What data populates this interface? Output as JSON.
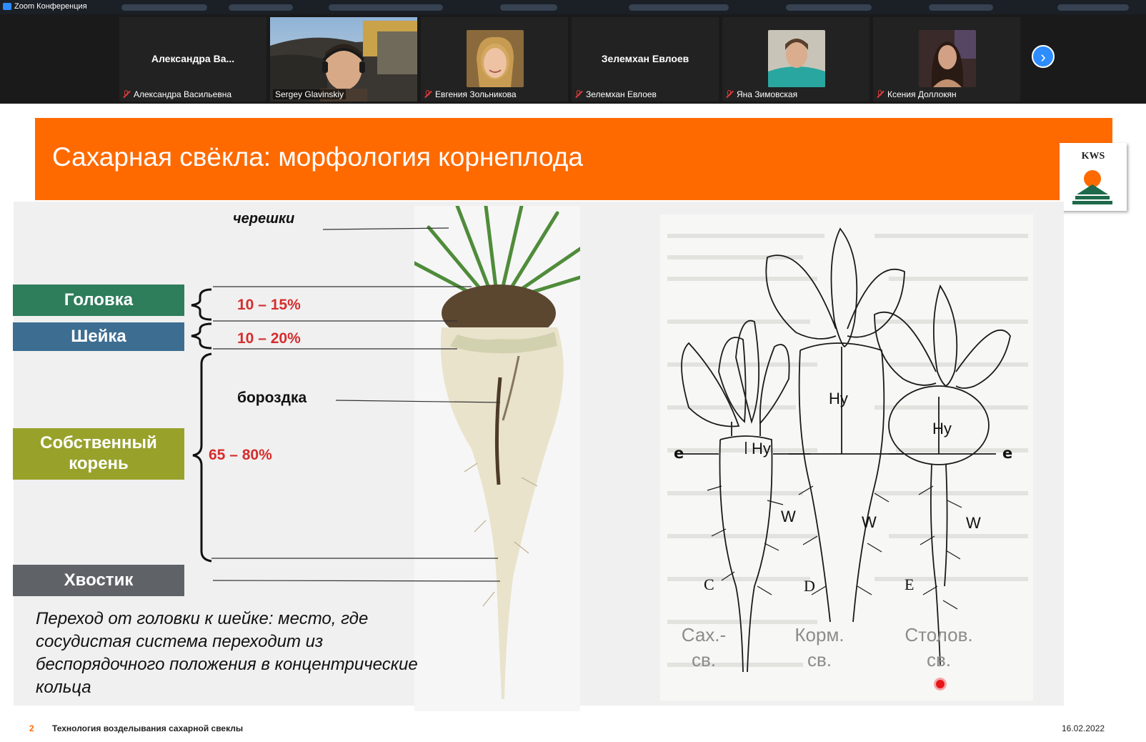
{
  "window": {
    "title": "Zoom Конференция"
  },
  "participants": {
    "tiles": [
      {
        "big_name": "Александра   Ва...",
        "name": "Александра Васильевна",
        "muted": true
      },
      {
        "big_name": "",
        "name": "Sergey Glavinskiy",
        "muted": false,
        "active": true
      },
      {
        "big_name": "",
        "name": "Евгения Зольникова",
        "muted": true
      },
      {
        "big_name": "Зелемхан Евлоев",
        "name": "Зелемхан Евлоев",
        "muted": true
      },
      {
        "big_name": "",
        "name": "Яна Зимовская",
        "muted": true
      },
      {
        "big_name": "",
        "name": "Ксения Доллокян",
        "muted": true
      }
    ],
    "next_icon": "chevron-right-icon"
  },
  "slide": {
    "title": "Сахарная свёкла: морфология корнеплода",
    "logo_text": "KWS",
    "labels": {
      "petioles": "черешки",
      "head": "Головка",
      "neck": "Шейка",
      "root": "Собственный корень",
      "tail": "Хвостик",
      "groove": "бороздка"
    },
    "percents": {
      "head": "10 – 15%",
      "neck": "10 – 20%",
      "root": "65 – 80%"
    },
    "note": "Переход от головки к шейке: место, где сосудистая система переходит из беспорядочного положения в концентрические кольца",
    "diagram": {
      "letters": {
        "c": "C",
        "d": "D",
        "e_cap": "E",
        "e": "e",
        "w": "W",
        "hy": "Hy"
      },
      "types": {
        "sugar": "Сах.- св.",
        "fodder": "Корм. св.",
        "table": "Столов. св."
      }
    },
    "footer": {
      "page": "2",
      "text": "Технология возделывания сахарной свеклы",
      "date": "16.02.2022"
    }
  },
  "colors": {
    "orange": "#ff6a00",
    "head": "#2e7d5b",
    "neck": "#3d6e92",
    "root": "#98a22b",
    "tail": "#5f6266",
    "percent": "#d62d2d",
    "zoom_blue": "#2d8cff"
  }
}
